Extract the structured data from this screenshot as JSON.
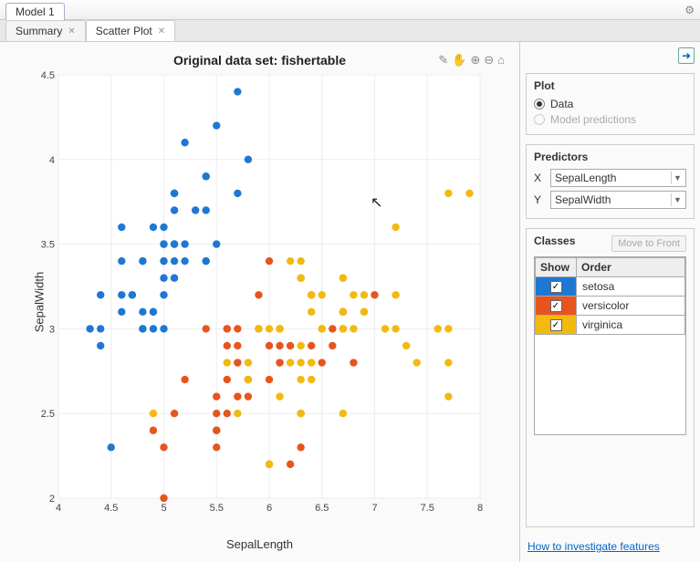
{
  "window": {
    "title": "Model 1"
  },
  "tabs": [
    {
      "label": "Summary",
      "active": false
    },
    {
      "label": "Scatter Plot",
      "active": true
    }
  ],
  "chart_title": "Original data set: fishertable",
  "toolbar_icons": [
    "brush-icon",
    "pan-icon",
    "zoom-in-icon",
    "zoom-out-icon",
    "home-icon"
  ],
  "axes": {
    "xlabel": "SepalLength",
    "ylabel": "SepalWidth"
  },
  "side": {
    "plot_heading": "Plot",
    "radio_data": "Data",
    "radio_model": "Model predictions",
    "predictors_heading": "Predictors",
    "x_label": "X",
    "y_label": "Y",
    "x_value": "SepalLength",
    "y_value": "SepalWidth",
    "classes_heading": "Classes",
    "move_to_front": "Move to Front",
    "th_show": "Show",
    "th_order": "Order",
    "classes": [
      {
        "color": "#1f77d4",
        "name": "setosa",
        "checked": true
      },
      {
        "color": "#e8541e",
        "name": "versicolor",
        "checked": true
      },
      {
        "color": "#f2b90f",
        "name": "virginica",
        "checked": true
      }
    ],
    "howto": "How to investigate features"
  },
  "chart_data": {
    "type": "scatter",
    "title": "Original data set: fishertable",
    "xlabel": "SepalLength",
    "ylabel": "SepalWidth",
    "xlim": [
      4,
      8
    ],
    "ylim": [
      2,
      4.5
    ],
    "xticks": [
      4,
      4.5,
      5,
      5.5,
      6,
      6.5,
      7,
      7.5,
      8
    ],
    "yticks": [
      2,
      2.5,
      3,
      3.5,
      4,
      4.5
    ],
    "series": [
      {
        "name": "setosa",
        "color": "#1f77d4",
        "points": [
          [
            5.1,
            3.5
          ],
          [
            4.9,
            3.0
          ],
          [
            4.7,
            3.2
          ],
          [
            4.6,
            3.1
          ],
          [
            5.0,
            3.6
          ],
          [
            5.4,
            3.9
          ],
          [
            4.6,
            3.4
          ],
          [
            5.0,
            3.4
          ],
          [
            4.4,
            2.9
          ],
          [
            4.9,
            3.1
          ],
          [
            5.4,
            3.7
          ],
          [
            4.8,
            3.4
          ],
          [
            4.8,
            3.0
          ],
          [
            4.3,
            3.0
          ],
          [
            5.8,
            4.0
          ],
          [
            5.7,
            4.4
          ],
          [
            5.4,
            3.9
          ],
          [
            5.1,
            3.5
          ],
          [
            5.7,
            3.8
          ],
          [
            5.1,
            3.8
          ],
          [
            5.4,
            3.4
          ],
          [
            5.1,
            3.7
          ],
          [
            4.6,
            3.6
          ],
          [
            5.1,
            3.3
          ],
          [
            4.8,
            3.4
          ],
          [
            5.0,
            3.0
          ],
          [
            5.0,
            3.4
          ],
          [
            5.2,
            3.5
          ],
          [
            5.2,
            3.4
          ],
          [
            4.7,
            3.2
          ],
          [
            4.8,
            3.1
          ],
          [
            5.4,
            3.4
          ],
          [
            5.2,
            4.1
          ],
          [
            5.5,
            4.2
          ],
          [
            4.9,
            3.1
          ],
          [
            5.0,
            3.2
          ],
          [
            5.5,
            3.5
          ],
          [
            4.9,
            3.6
          ],
          [
            4.4,
            3.0
          ],
          [
            5.1,
            3.4
          ],
          [
            5.0,
            3.5
          ],
          [
            4.5,
            2.3
          ],
          [
            4.4,
            3.2
          ],
          [
            5.0,
            3.5
          ],
          [
            5.1,
            3.8
          ],
          [
            4.8,
            3.0
          ],
          [
            5.1,
            3.8
          ],
          [
            4.6,
            3.2
          ],
          [
            5.3,
            3.7
          ],
          [
            5.0,
            3.3
          ]
        ]
      },
      {
        "name": "versicolor",
        "color": "#e8541e",
        "points": [
          [
            7.0,
            3.2
          ],
          [
            6.4,
            3.2
          ],
          [
            6.9,
            3.1
          ],
          [
            5.5,
            2.3
          ],
          [
            6.5,
            2.8
          ],
          [
            5.7,
            2.8
          ],
          [
            6.3,
            3.3
          ],
          [
            4.9,
            2.4
          ],
          [
            6.6,
            2.9
          ],
          [
            5.2,
            2.7
          ],
          [
            5.0,
            2.0
          ],
          [
            5.9,
            3.0
          ],
          [
            6.0,
            2.2
          ],
          [
            6.1,
            2.9
          ],
          [
            5.6,
            2.9
          ],
          [
            6.7,
            3.1
          ],
          [
            5.6,
            3.0
          ],
          [
            5.8,
            2.7
          ],
          [
            6.2,
            2.2
          ],
          [
            5.6,
            2.5
          ],
          [
            5.9,
            3.2
          ],
          [
            6.1,
            2.8
          ],
          [
            6.3,
            2.5
          ],
          [
            6.1,
            2.8
          ],
          [
            6.4,
            2.9
          ],
          [
            6.6,
            3.0
          ],
          [
            6.8,
            2.8
          ],
          [
            6.7,
            3.0
          ],
          [
            6.0,
            2.9
          ],
          [
            5.7,
            2.6
          ],
          [
            5.5,
            2.4
          ],
          [
            5.5,
            2.4
          ],
          [
            5.8,
            2.7
          ],
          [
            6.0,
            2.7
          ],
          [
            5.4,
            3.0
          ],
          [
            6.0,
            3.4
          ],
          [
            6.7,
            3.1
          ],
          [
            6.3,
            2.3
          ],
          [
            5.6,
            3.0
          ],
          [
            5.5,
            2.5
          ],
          [
            5.5,
            2.6
          ],
          [
            6.1,
            3.0
          ],
          [
            5.8,
            2.6
          ],
          [
            5.0,
            2.3
          ],
          [
            5.6,
            2.7
          ],
          [
            5.7,
            3.0
          ],
          [
            5.7,
            2.9
          ],
          [
            6.2,
            2.9
          ],
          [
            5.1,
            2.5
          ],
          [
            5.7,
            2.8
          ]
        ]
      },
      {
        "name": "virginica",
        "color": "#f2b90f",
        "points": [
          [
            6.3,
            3.3
          ],
          [
            5.8,
            2.7
          ],
          [
            7.1,
            3.0
          ],
          [
            6.3,
            2.9
          ],
          [
            6.5,
            3.0
          ],
          [
            7.6,
            3.0
          ],
          [
            4.9,
            2.5
          ],
          [
            7.3,
            2.9
          ],
          [
            6.7,
            2.5
          ],
          [
            7.2,
            3.6
          ],
          [
            6.5,
            3.2
          ],
          [
            6.4,
            2.7
          ],
          [
            6.8,
            3.0
          ],
          [
            5.7,
            2.5
          ],
          [
            5.8,
            2.8
          ],
          [
            6.4,
            3.2
          ],
          [
            6.5,
            3.0
          ],
          [
            7.7,
            3.8
          ],
          [
            7.7,
            2.6
          ],
          [
            6.0,
            2.2
          ],
          [
            6.9,
            3.2
          ],
          [
            5.6,
            2.8
          ],
          [
            7.7,
            2.8
          ],
          [
            6.3,
            2.7
          ],
          [
            6.7,
            3.3
          ],
          [
            7.2,
            3.2
          ],
          [
            6.2,
            2.8
          ],
          [
            6.1,
            3.0
          ],
          [
            6.4,
            2.8
          ],
          [
            7.2,
            3.0
          ],
          [
            7.4,
            2.8
          ],
          [
            7.9,
            3.8
          ],
          [
            6.4,
            2.8
          ],
          [
            6.3,
            2.8
          ],
          [
            6.1,
            2.6
          ],
          [
            7.7,
            3.0
          ],
          [
            6.3,
            3.4
          ],
          [
            6.4,
            3.1
          ],
          [
            6.0,
            3.0
          ],
          [
            6.9,
            3.1
          ],
          [
            6.7,
            3.1
          ],
          [
            6.9,
            3.1
          ],
          [
            5.8,
            2.7
          ],
          [
            6.8,
            3.2
          ],
          [
            6.7,
            3.3
          ],
          [
            6.7,
            3.0
          ],
          [
            6.3,
            2.5
          ],
          [
            6.5,
            3.0
          ],
          [
            6.2,
            3.4
          ],
          [
            5.9,
            3.0
          ]
        ]
      }
    ]
  }
}
